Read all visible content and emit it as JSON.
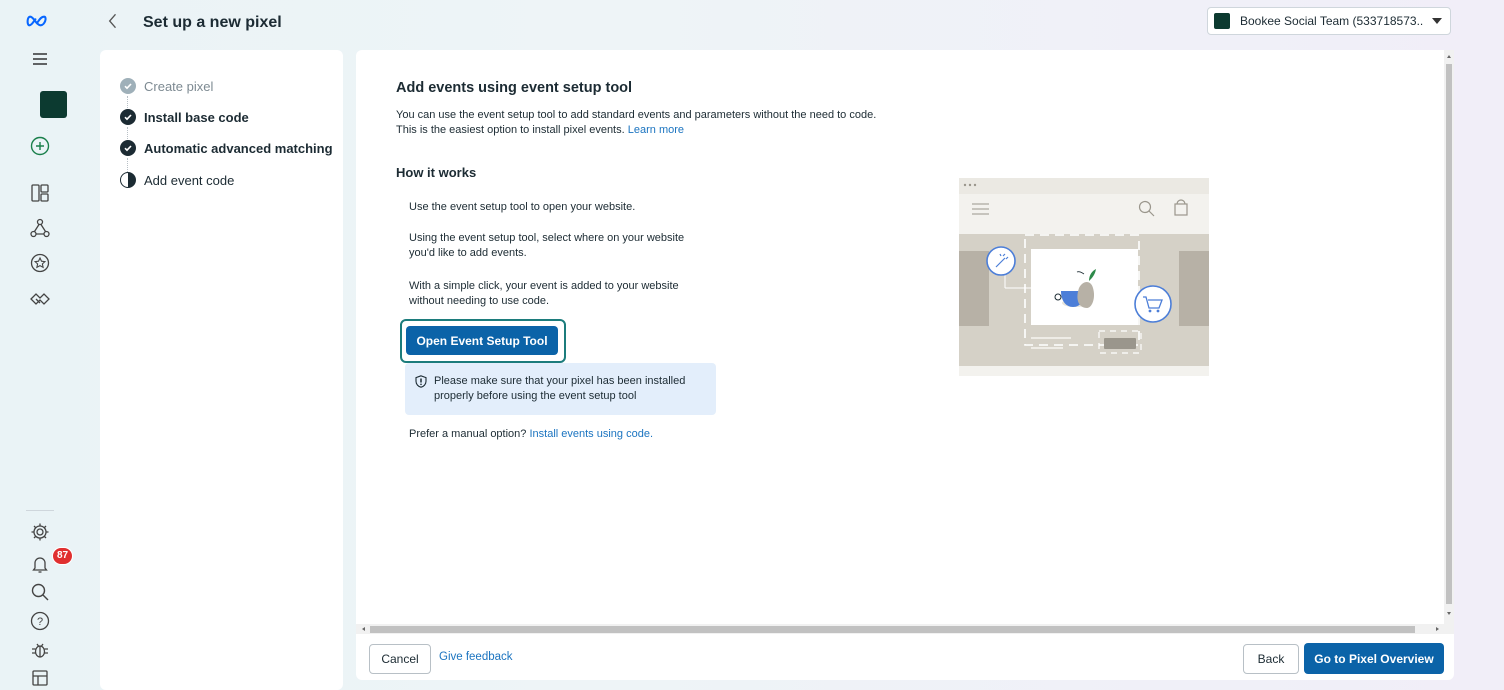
{
  "header": {
    "title": "Set up a new pixel",
    "account_name": "Bookee Social Team (533718573..."
  },
  "nav": {
    "icons": [
      "meta-logo-icon",
      "menu-icon",
      "account-icon",
      "create-icon",
      "dashboard-icon",
      "network-icon",
      "star-icon",
      "handshake-icon",
      "settings-icon",
      "notifications-icon",
      "search-icon",
      "help-icon",
      "bug-icon",
      "panel-icon"
    ],
    "notification_count": "87"
  },
  "steps": [
    {
      "label": "Create pixel",
      "status": "done-muted"
    },
    {
      "label": "Install base code",
      "status": "done"
    },
    {
      "label": "Automatic advanced matching",
      "status": "done"
    },
    {
      "label": "Add event code",
      "status": "in-progress"
    }
  ],
  "main": {
    "heading": "Add events using event setup tool",
    "description": "You can use the event setup tool to add standard events and parameters without the need to code. This is the easiest option to install pixel events.",
    "learn_more": "Learn more",
    "how_heading": "How it works",
    "how_steps": [
      "Use the event setup tool to open your website.",
      "Using the event setup tool, select where on your website you'd like to add events.",
      "With a simple click, your event is added to your website without needing to use code."
    ],
    "open_tool_button": "Open Event Setup Tool",
    "note": "Please make sure that your pixel has been installed properly before using the event setup tool",
    "manual_prefix": "Prefer a manual option?",
    "manual_link": "Install events using code."
  },
  "footer": {
    "cancel": "Cancel",
    "feedback": "Give feedback",
    "back": "Back",
    "go": "Go to Pixel Overview"
  },
  "colors": {
    "primary": "#0b63a8",
    "link": "#1b74c0",
    "focus_ring": "#1c7c7c",
    "done_check": "#1c2b33",
    "muted_check": "#8a9aa3",
    "note_bg": "#e3eefb"
  }
}
